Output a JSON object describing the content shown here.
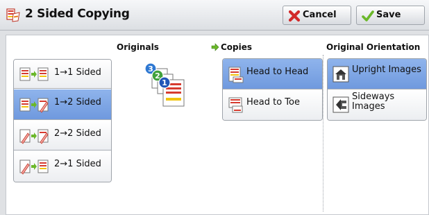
{
  "window": {
    "title": "2 Sided Copying",
    "cancel_label": "Cancel",
    "save_label": "Save"
  },
  "sections": {
    "originals_header": "Originals",
    "copies_header": "Copies",
    "orientation_header": "Original Orientation"
  },
  "sided_options": [
    {
      "label": "1→1 Sided",
      "selected": false
    },
    {
      "label": "1→2 Sided",
      "selected": true
    },
    {
      "label": "2→2 Sided",
      "selected": false
    },
    {
      "label": "2→1 Sided",
      "selected": false
    }
  ],
  "copies_options": [
    {
      "label": "Head to Head",
      "selected": true
    },
    {
      "label": "Head to Toe",
      "selected": false
    }
  ],
  "orientation_options": [
    {
      "label": "Upright Images",
      "selected": true
    },
    {
      "label": "Sideways Images",
      "selected": false
    }
  ],
  "originals_badges": [
    "3",
    "2",
    "1"
  ],
  "colors": {
    "selected_bg": "#7ea6e6",
    "cancel_red": "#d22a2a",
    "save_green": "#6bb82a",
    "header_arrow": "#4f9e25"
  }
}
